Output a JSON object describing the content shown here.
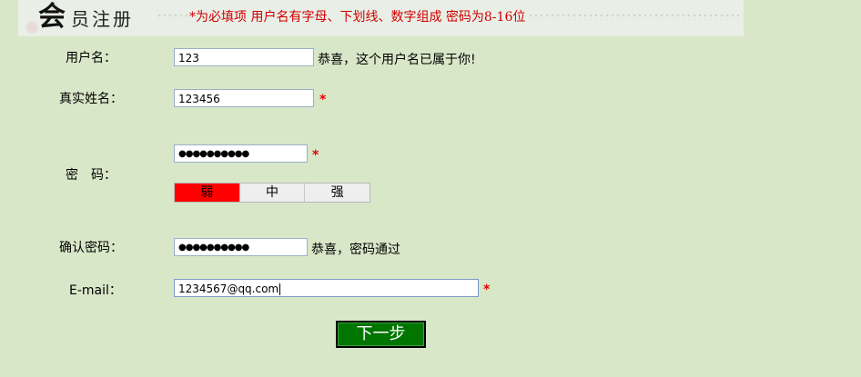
{
  "header": {
    "title_big": "会",
    "title_small": "员注册",
    "notice": "*为必填项 用户名有字母、下划线、数字组成 密码为8-16位"
  },
  "form": {
    "username": {
      "label": "用户名：",
      "value": "123",
      "message": "恭喜，这个用户名已属于你!"
    },
    "realname": {
      "label": "真实姓名：",
      "value": "123456",
      "required": "*"
    },
    "password": {
      "label": "密　码：",
      "masked": "●●●●●●●●●●",
      "required": "*",
      "strength": {
        "weak": "弱",
        "medium": "中",
        "strong": "强",
        "active": "weak"
      }
    },
    "confirm": {
      "label": "确认密码：",
      "masked": "●●●●●●●●●●",
      "message": "恭喜，密码通过"
    },
    "email": {
      "label": "E-mail：",
      "value": "1234567@qq.com",
      "required": "*"
    },
    "next_label": "下一步"
  },
  "colors": {
    "background": "#d9e7c9",
    "required": "#e00000",
    "weak": "#ff0000",
    "button": "#007500"
  }
}
